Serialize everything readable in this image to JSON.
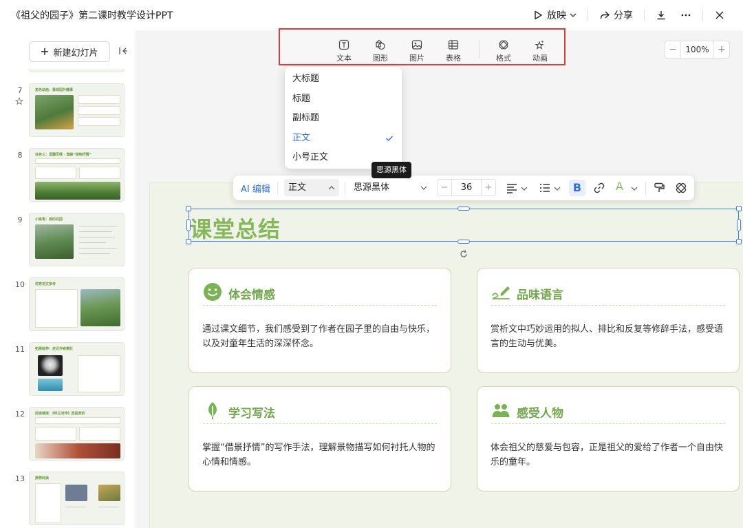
{
  "app": {
    "doc_title": "《祖父的园子》第二课时教学设计PPT",
    "play_label": "放映",
    "share_label": "分享"
  },
  "sidebar": {
    "new_slide_label": "新建幻灯片",
    "slides": [
      {
        "num": "7",
        "title": "角色动画：重现园外趣事"
      },
      {
        "num": "8",
        "title": "任务三：里翻页情 · 理解“借物抒情”"
      },
      {
        "num": "9",
        "title": "小练笔：我的花园"
      },
      {
        "num": "10",
        "title": "优秀范文参考"
      },
      {
        "num": "11",
        "title": "拓展延伸：走近作者萧红"
      },
      {
        "num": "12",
        "title": "阅读链接：《呼兰河传》选段赏析"
      },
      {
        "num": "13",
        "title": "推荐阅读"
      }
    ]
  },
  "insert_toolbar": {
    "items": [
      "文本",
      "图形",
      "图片",
      "表格",
      "格式",
      "动画"
    ]
  },
  "zoom": {
    "value": "100%"
  },
  "style_dropdown": {
    "items": [
      "大标题",
      "标题",
      "副标题",
      "正文",
      "小号正文"
    ],
    "selected": "正文"
  },
  "tooltip": {
    "text": "思源黑体"
  },
  "format_toolbar": {
    "ai_label": "AI 编辑",
    "style_value": "正文",
    "font_value": "思源黑体",
    "size_value": "36",
    "bold_label": "B",
    "color_label": "A"
  },
  "slide": {
    "title": "课堂总结",
    "cards": [
      {
        "title": "体会情感",
        "icon": "smile-icon",
        "text": "通过课文细节，我们感受到了作者在园子里的自由与快乐，以及对童年生活的深深怀念。"
      },
      {
        "title": "品味语言",
        "icon": "pen-signature-icon",
        "text": "赏析文中巧妙运用的拟人、排比和反复等修辞手法，感受语言的生动与优美。"
      },
      {
        "title": "学习写法",
        "icon": "leaf-icon",
        "text": "掌握“借景抒情”的写作手法，理解景物描写如何衬托人物的心情和情感。"
      },
      {
        "title": "感受人物",
        "icon": "people-icon",
        "text": "体会祖父的慈爱与包容，正是祖父的爱给了作者一个自由快乐的童年。"
      }
    ]
  },
  "colors": {
    "accent_blue": "#2f6fde",
    "title_green": "#86b85b",
    "card_green": "#72a84d",
    "highlight_red": "#e03b3b"
  }
}
